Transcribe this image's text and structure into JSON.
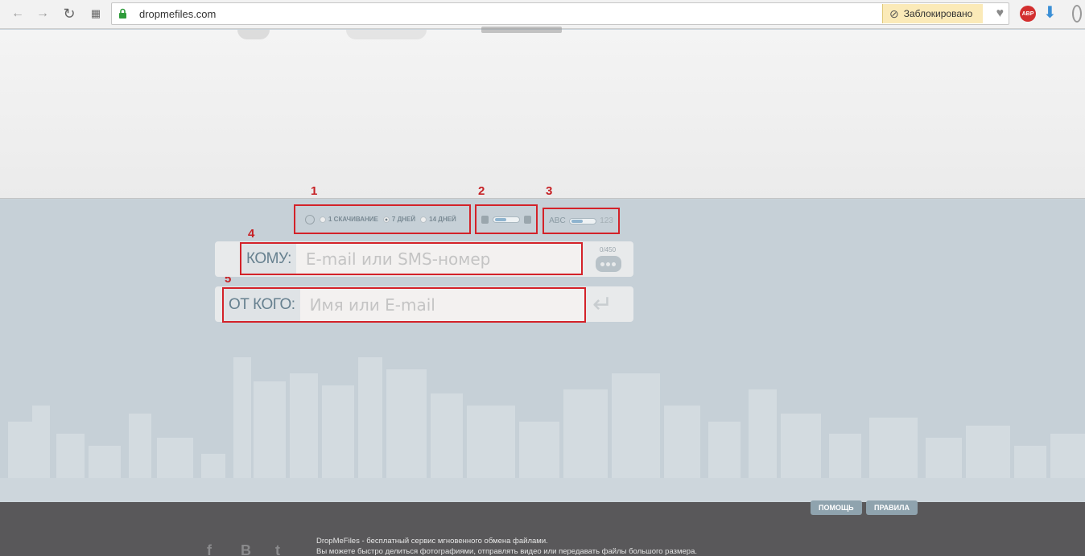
{
  "browser": {
    "url": "dropmefiles.com",
    "blocked_label": "Заблокировано",
    "abp_label": "ABP"
  },
  "options": {
    "markers": [
      "1",
      "2",
      "3",
      "4",
      "5"
    ],
    "downloads": [
      {
        "label": "1 СКАЧИВАНИЕ",
        "selected": false
      },
      {
        "label": "7 ДНЕЙ",
        "selected": true
      },
      {
        "label": "14 ДНЕЙ",
        "selected": false
      }
    ],
    "code_left": "ABC",
    "code_right": "123"
  },
  "form": {
    "to_label": "КОМУ:",
    "to_placeholder": "E-mail или SMS-номер",
    "counter": "0/450",
    "from_label": "ОТ КОГО:",
    "from_placeholder": "Имя или E-mail"
  },
  "footer": {
    "help_button": "ПОМОЩЬ",
    "rules_button": "ПРАВИЛА",
    "social": [
      "f",
      "B",
      "t"
    ],
    "line1": "DropMeFiles - бесплатный сервис мгновенного обмена файлами.",
    "line2": "Вы можете быстро делиться фотографиями, отправлять видео или передавать файлы большого размера."
  },
  "colors": {
    "highlight": "#d32229",
    "footer_bg": "#59585a"
  }
}
